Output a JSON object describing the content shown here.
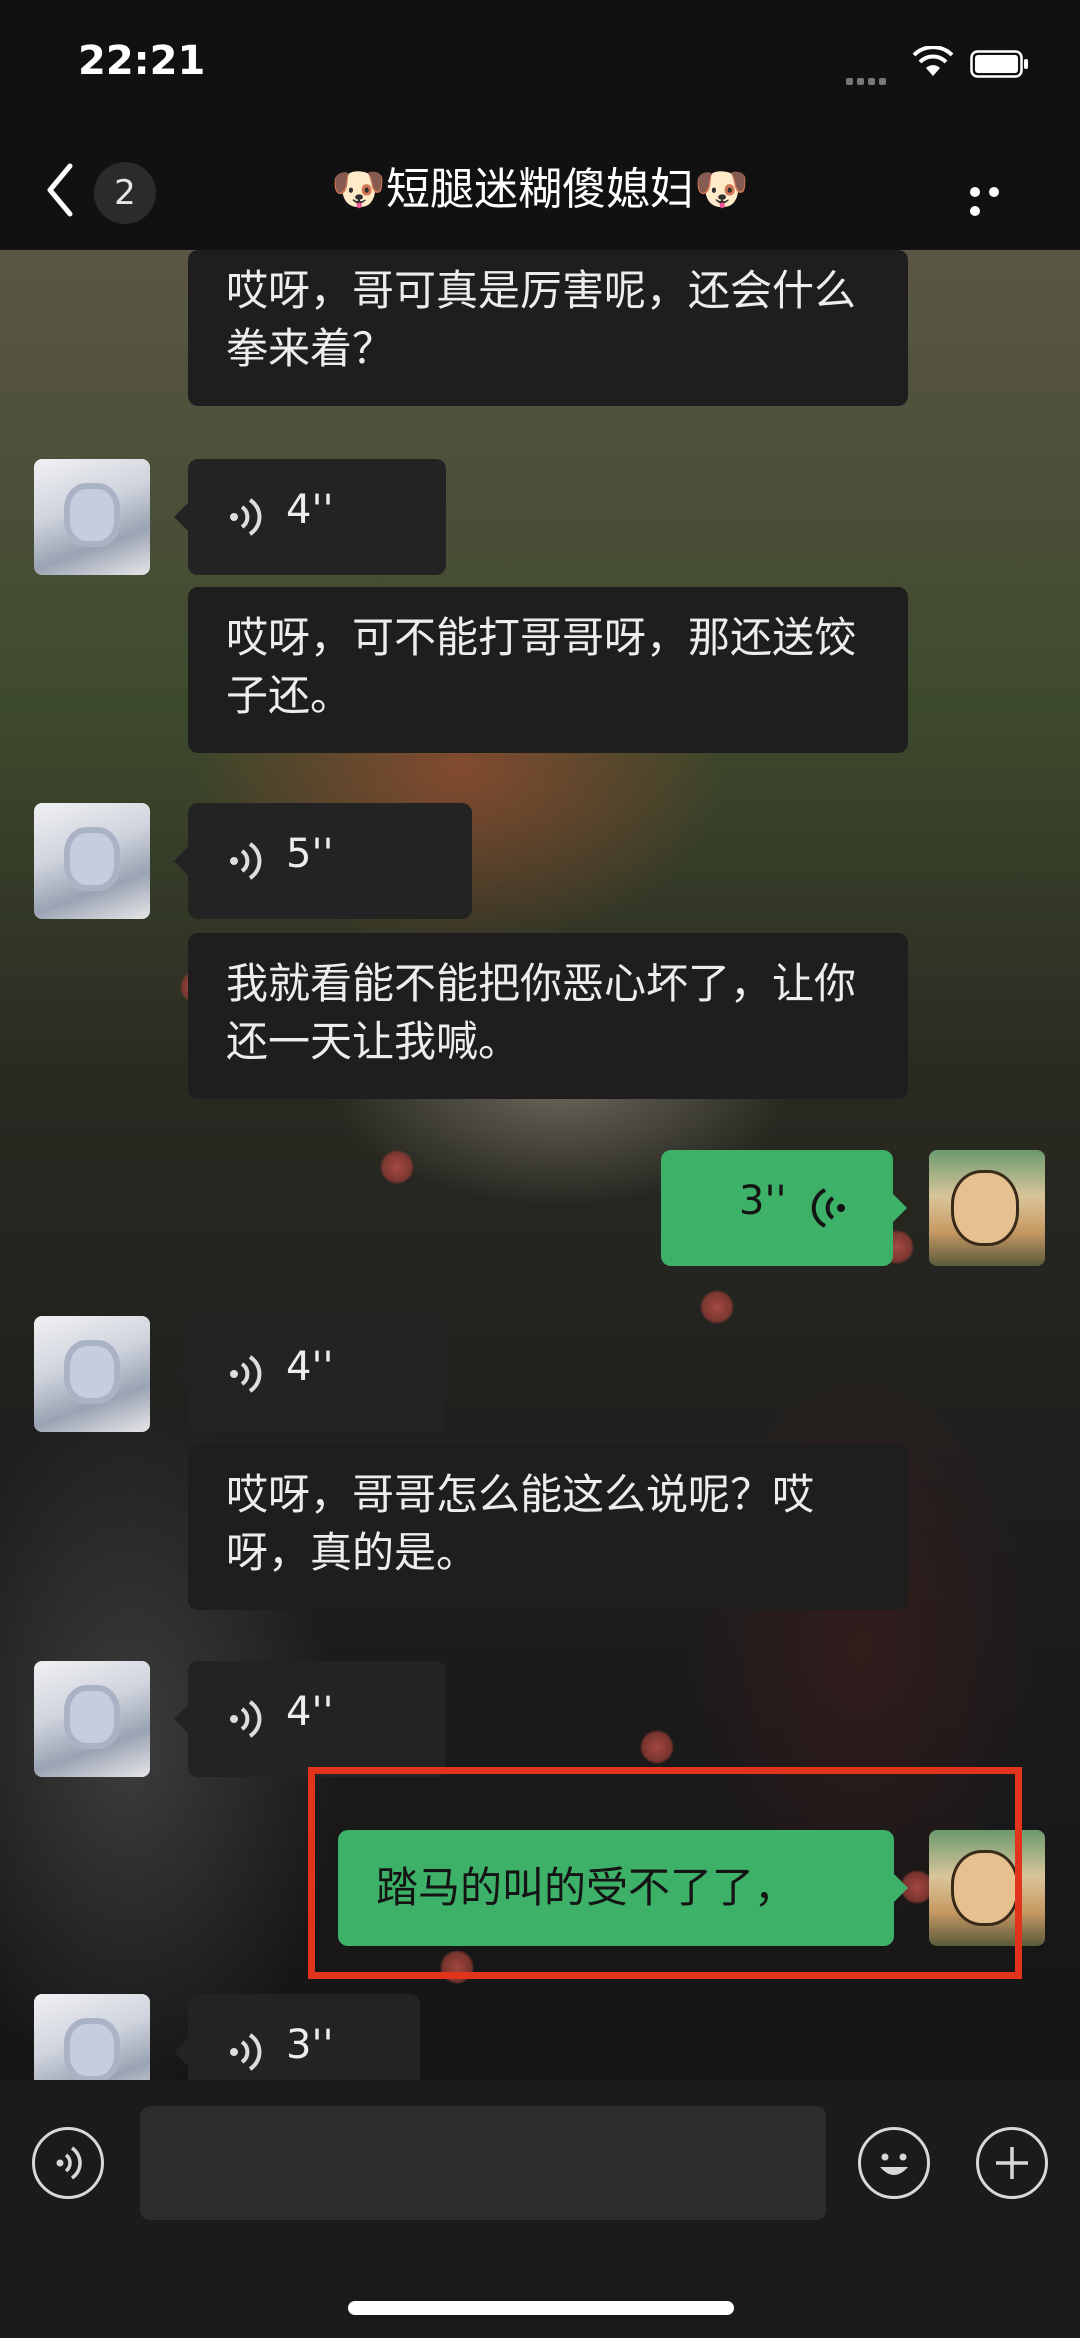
{
  "status_bar": {
    "time": "22:21"
  },
  "nav": {
    "unread_count": "2",
    "title": "🐶短腿迷糊傻媳妇🐶"
  },
  "messages": {
    "m1_text": "哎呀，哥可真是厉害呢，还会什么拳来着？",
    "m2_voice": "4''",
    "m3_text": "哎呀，可不能打哥哥呀，那还送饺子还。",
    "m4_voice": "5''",
    "m5_text": "我就看能不能把你恶心坏了，让你还一天让我喊。",
    "m6_self_voice": "3''",
    "m7_voice": "4''",
    "m8_text": "哎呀，哥哥怎么能这么说呢？哎呀，真的是。",
    "m9_voice": "4''",
    "m10_self_text": "踏马的叫的受不了了，",
    "m11_voice": "3''"
  },
  "colors": {
    "self_bubble": "#3eb168",
    "other_bubble": "#1e1e1e",
    "highlight": "#e2341d"
  },
  "icons": [
    "back-icon",
    "more-icon",
    "voice-wave-icon",
    "voice-mode-icon",
    "emoji-icon",
    "plus-icon",
    "wifi-icon",
    "battery-icon",
    "signal-icon"
  ]
}
